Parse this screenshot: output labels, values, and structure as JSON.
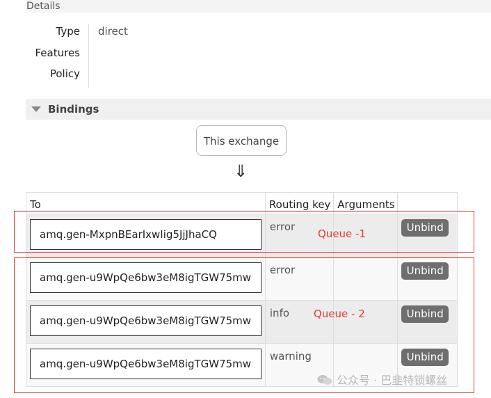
{
  "details": {
    "title": "Details",
    "labels": [
      "Type",
      "Features",
      "Policy"
    ],
    "type_value": "direct"
  },
  "bindings": {
    "title": "Bindings",
    "source_label": "This exchange",
    "arrow": "⇓",
    "columns": [
      "To",
      "Routing key",
      "Arguments"
    ],
    "rows": [
      {
        "queue": "amq.gen-MxpnBEarIxwIig5JjJhaCQ",
        "routing_key": "error",
        "action": "Unbind"
      },
      {
        "queue": "amq.gen-u9WpQe6bw3eM8igTGW75mw",
        "routing_key": "error",
        "action": "Unbind"
      },
      {
        "queue": "amq.gen-u9WpQe6bw3eM8igTGW75mw",
        "routing_key": "info",
        "action": "Unbind"
      },
      {
        "queue": "amq.gen-u9WpQe6bw3eM8igTGW75mw",
        "routing_key": "warning",
        "action": "Unbind"
      }
    ]
  },
  "annotations": {
    "queue1": "Queue -1",
    "queue2": "Queue - 2",
    "color": "#e53935"
  },
  "watermark": {
    "text": "公众号 · 巴韭特锁螺丝",
    "icon": "wechat-icon"
  }
}
